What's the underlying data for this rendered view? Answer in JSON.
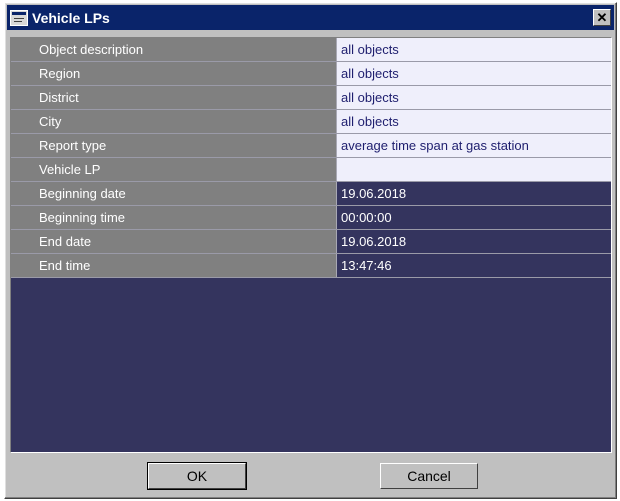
{
  "window": {
    "title": "Vehicle LPs",
    "close_glyph": "✕"
  },
  "properties": [
    {
      "label": "Object description",
      "value": "all objects",
      "style": "light"
    },
    {
      "label": "Region",
      "value": "all objects",
      "style": "light"
    },
    {
      "label": "District",
      "value": "all objects",
      "style": "light"
    },
    {
      "label": "City",
      "value": "all objects",
      "style": "light"
    },
    {
      "label": "Report type",
      "value": "average time span at gas station",
      "style": "light"
    },
    {
      "label": "Vehicle LP",
      "value": "",
      "style": "light"
    },
    {
      "label": "Beginning date",
      "value": "19.06.2018",
      "style": "dark"
    },
    {
      "label": "Beginning time",
      "value": "00:00:00",
      "style": "dark"
    },
    {
      "label": "End date",
      "value": "19.06.2018",
      "style": "dark"
    },
    {
      "label": "End time",
      "value": "13:47:46",
      "style": "dark"
    }
  ],
  "buttons": {
    "ok": "OK",
    "cancel": "Cancel"
  }
}
